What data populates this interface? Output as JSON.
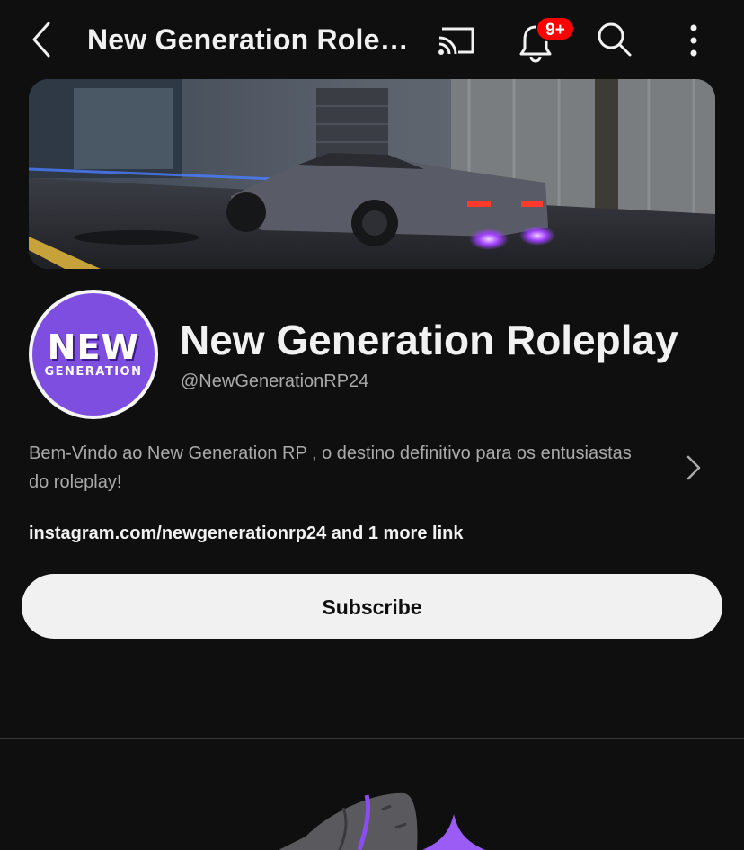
{
  "topbar": {
    "title": "New Generation Rolep...",
    "notification_badge": "9+",
    "icons": [
      "back-icon",
      "cast-icon",
      "bell-icon",
      "search-icon",
      "more-vertical-icon"
    ]
  },
  "channel": {
    "avatar_text_line1": "NEW",
    "avatar_text_line2": "GENERATION",
    "name": "New Generation Roleplay",
    "handle": "@NewGenerationRP24",
    "description": "Bem-Vindo ao New Generation RP , o destino definitivo para os entusiastas do roleplay!",
    "link_primary": "instagram.com/newgenerationrp24",
    "link_more": "and 1 more link",
    "subscribe_label": "Subscribe"
  },
  "colors": {
    "background": "#0f0f0f",
    "avatar": "#7d4ee0",
    "badge": "#ff0000",
    "subscribe_bg": "#f1f1f1"
  }
}
